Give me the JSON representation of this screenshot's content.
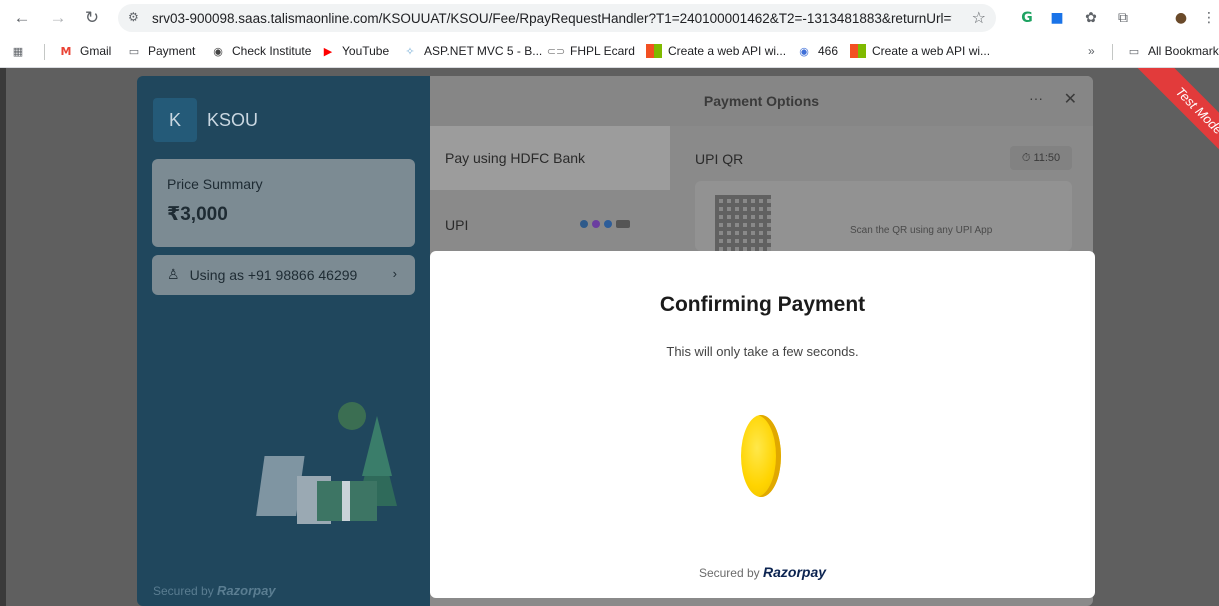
{
  "browser": {
    "url": "srv03-900098.saas.talismaonline.com/KSOUUAT/KSOU/Fee/RpayRequestHandler?T1=240100001462&T2=-1313481883&returnUrl=%...",
    "bookmarks": [
      {
        "label": "Gmail",
        "icon": "gmail-icon"
      },
      {
        "label": "Payment",
        "icon": "folder-icon"
      },
      {
        "label": "Check Institute",
        "icon": "globe-icon"
      },
      {
        "label": "YouTube",
        "icon": "youtube-icon"
      },
      {
        "label": "ASP.NET MVC 5 - B...",
        "icon": "aspnet-icon"
      },
      {
        "label": "FHPL Ecard",
        "icon": "link-icon"
      },
      {
        "label": "Create a web API wi...",
        "icon": "microsoft-icon"
      },
      {
        "label": "466",
        "icon": "site-icon"
      },
      {
        "label": "Create a web API wi...",
        "icon": "microsoft-icon"
      }
    ],
    "more_bookmarks": "»",
    "all_bookmarks": "All Bookmarks"
  },
  "merchant": {
    "initial": "K",
    "name": "KSOU",
    "price_label": "Price Summary",
    "price": "₹3,000",
    "using_as": "Using as +91 98866 46299",
    "secured_by": "Secured by",
    "razorpay": "Razorpay"
  },
  "payment_options": {
    "title": "Payment Options",
    "menu": "···",
    "close": "✕",
    "pay_hdfc": "Pay using HDFC Bank",
    "upi": "UPI",
    "upi_qr": "UPI QR",
    "timer": "⏱ 11:50",
    "scan_text": "Scan the QR using any UPI App"
  },
  "modal": {
    "title": "Confirming Payment",
    "subtitle": "This will only take a few seconds.",
    "secured_by": "Secured by",
    "razorpay": "Razorpay"
  },
  "ribbon": "Test Mode",
  "colors": {
    "overlay": "#5f5f5f",
    "brand_panel": "#20475d",
    "ribbon": "#e23b3b",
    "coin": "#ffd400",
    "razorpay_text": "#0c2451"
  }
}
